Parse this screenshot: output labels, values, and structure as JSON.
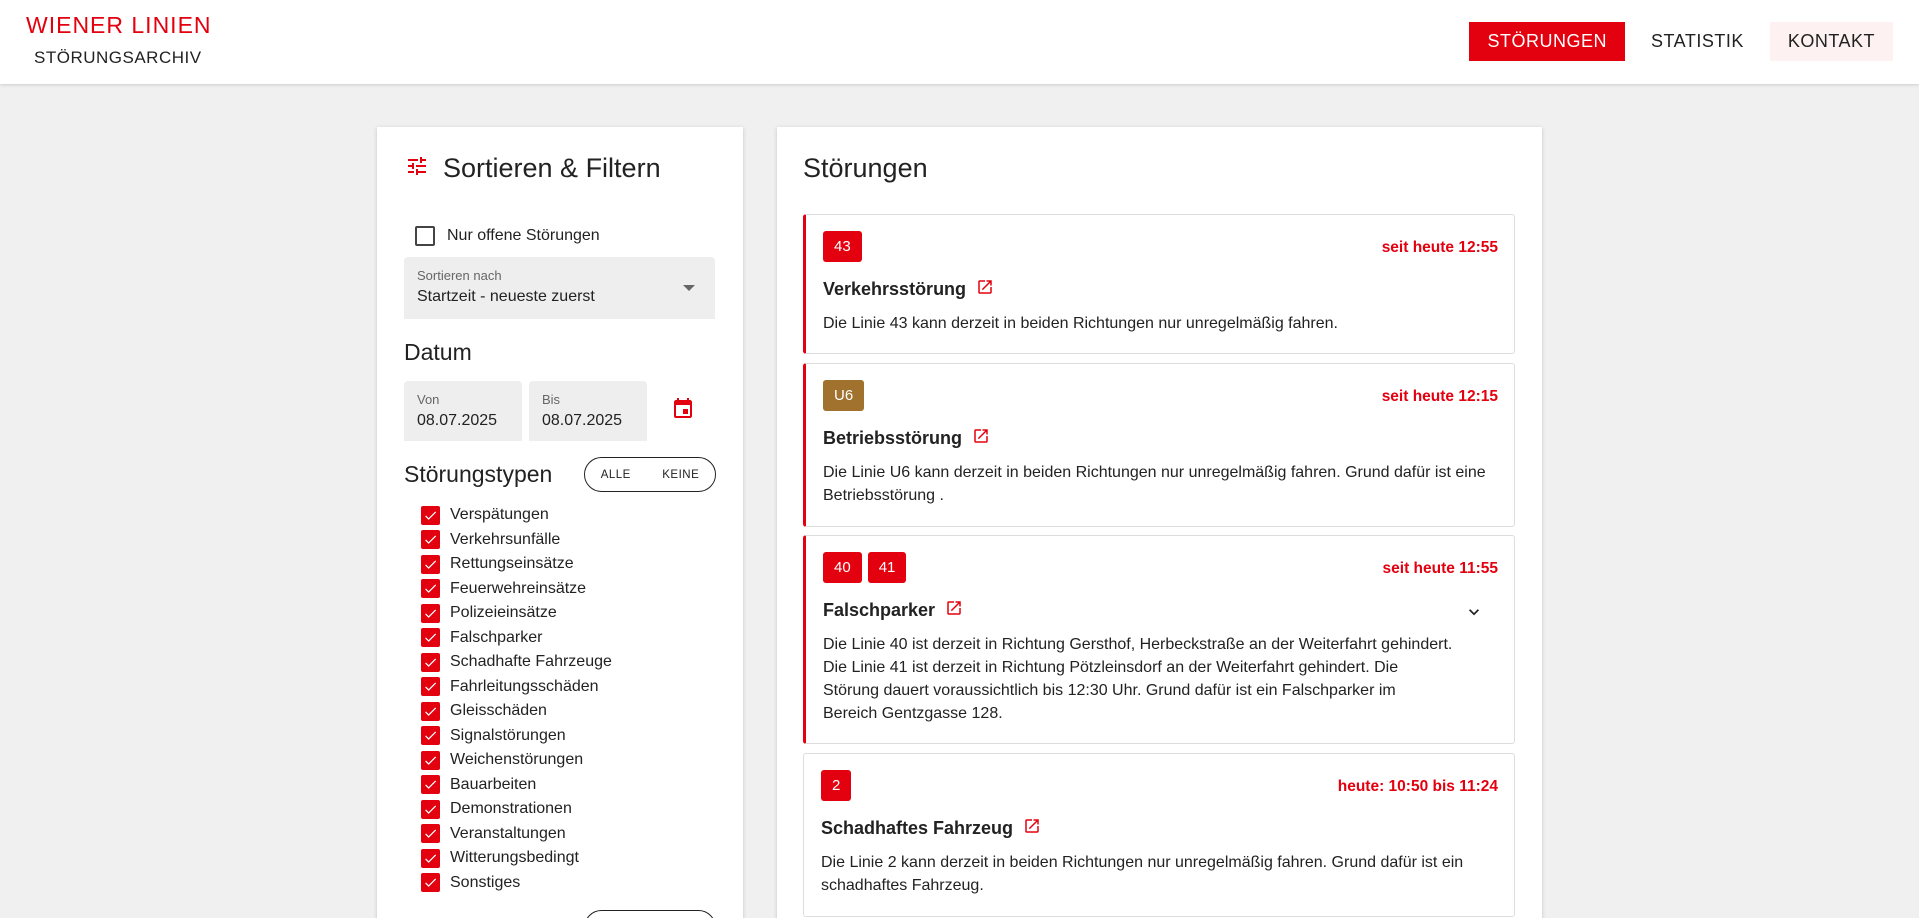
{
  "header": {
    "brand": "WIENER LINIEN",
    "subtitle": "STÖRUNGSARCHIV",
    "nav": [
      {
        "label": "STÖRUNGEN"
      },
      {
        "label": "STATISTIK"
      },
      {
        "label": "KONTAKT"
      }
    ]
  },
  "filters": {
    "title": "Sortieren & Filtern",
    "only_open_label": "Nur offene Störungen",
    "sort_label": "Sortieren nach",
    "sort_value": "Startzeit - neueste zuerst",
    "date_title": "Datum",
    "from_label": "Von",
    "from_value": "08.07.2025",
    "to_label": "Bis",
    "to_value": "08.07.2025",
    "types_title": "Störungstypen",
    "all_label": "ALLE",
    "none_label": "KEINE",
    "types": [
      "Verspätungen",
      "Verkehrsunfälle",
      "Rettungseinsätze",
      "Feuerwehreinsätze",
      "Polizeieinsätze",
      "Falschparker",
      "Schadhafte Fahrzeuge",
      "Fahrleitungsschäden",
      "Gleisschäden",
      "Signalstörungen",
      "Weichenstörungen",
      "Bauarbeiten",
      "Demonstrationen",
      "Veranstaltungen",
      "Witterungsbedingt",
      "Sonstiges"
    ]
  },
  "list": {
    "title": "Störungen",
    "items": [
      {
        "lines": [
          "43"
        ],
        "time": "seit heute 12:55",
        "title": "Verkehrsstörung",
        "text": "Die Linie 43 kann derzeit in beiden Richtungen nur unregelmäßig fahren."
      },
      {
        "lines": [
          "U6"
        ],
        "time": "seit heute 12:15",
        "title": "Betriebsstörung",
        "text": "Die Linie U6 kann derzeit in beiden Richtungen nur unregelmäßig fahren. Grund dafür ist eine Betriebsstörung ."
      },
      {
        "lines": [
          "40",
          "41"
        ],
        "time": "seit heute 11:55",
        "title": "Falschparker",
        "text": "Die Linie 40 ist derzeit in Richtung Gersthof, Herbeckstraße an der Weiterfahrt gehindert. Die Linie 41 ist derzeit in Richtung Pötzleinsdorf an der Weiterfahrt gehindert. Die Störung dauert voraussichtlich bis 12:30 Uhr. Grund dafür ist ein Falschparker im Bereich Gentzgasse 128."
      },
      {
        "lines": [
          "2"
        ],
        "time": "heute: 10:50 bis 11:24",
        "title": "Schadhaftes Fahrzeug",
        "text": "Die Linie 2 kann derzeit in beiden Richtungen nur unregelmäßig fahren. Grund dafür ist ein schadhaftes Fahrzeug."
      }
    ]
  },
  "colors": {
    "accent": "#e3000f",
    "u6": "#a0722e"
  }
}
